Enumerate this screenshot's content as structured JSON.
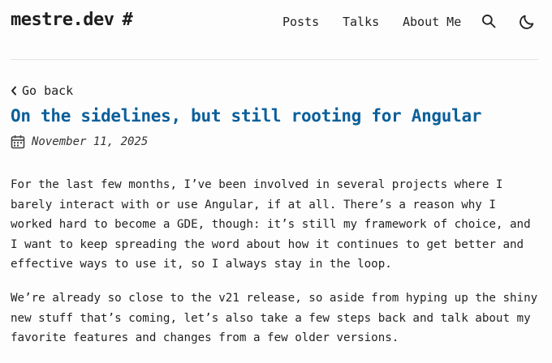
{
  "header": {
    "logo_text": "mestre.dev",
    "logo_hash": "#",
    "nav": {
      "posts": "Posts",
      "talks": "Talks",
      "about": "About Me"
    },
    "icons": [
      "search-icon",
      "moon-icon"
    ]
  },
  "article": {
    "back_label": "Go back",
    "title": "On the sidelines, but still rooting for Angular",
    "date": "November 11, 2025",
    "paragraphs": [
      {
        "lines": [
          "For the last few months, I’ve been involved in several projects where I",
          "barely interact with or use Angular, if at all. There’s a reason why I",
          "worked hard to become a GDE, though: it’s still my framework of choice, and",
          "I want to keep spreading the word about how it continues to get better and",
          "effective ways to use it, so I always stay in the loop."
        ]
      },
      {
        "lines": [
          "We’re already so close to the v21 release, so aside from hyping up the shiny",
          "new stuff that’s coming, let’s also take a few steps back and talk about my",
          "favorite features and changes from a few older versions."
        ]
      }
    ]
  },
  "colors": {
    "title": "#0b5f9a",
    "text": "#222222",
    "background": "#fdfdfd",
    "divider": "#e3e3e3"
  }
}
